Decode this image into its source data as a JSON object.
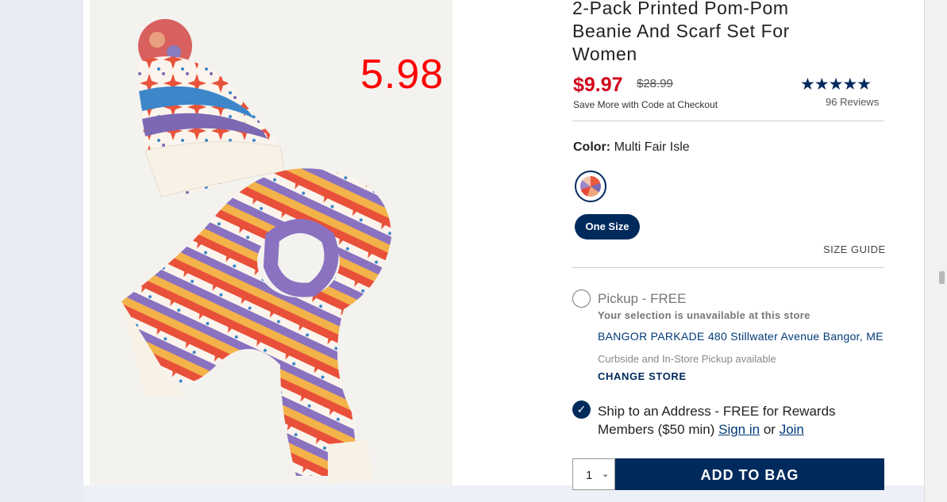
{
  "product": {
    "title": "2-Pack Printed Pom-Pom Beanie And Scarf Set For Women",
    "overlay_price": "5.98",
    "sale_price": "$9.97",
    "original_price": "$28.99",
    "save_note": "Save More with Code at Checkout",
    "rating_stars": "★★★★★",
    "rating": 5,
    "reviews": "96 Reviews"
  },
  "color": {
    "label": "Color:",
    "value": "Multi Fair Isle",
    "swatch_icon": "fair-isle-swatch"
  },
  "size": {
    "selected": "One Size",
    "guide_label": "SIZE GUIDE"
  },
  "fulfillment": {
    "pickup_label": "Pickup - FREE",
    "pickup_unavailable": "Your selection is unavailable at this store",
    "store_name": "BANGOR PARKADE 480 Stillwater Avenue  Bangor, ME",
    "curbside": "Curbside and In-Store Pickup available",
    "change_store": "CHANGE STORE",
    "ship_label": "Ship to an Address - FREE for Rewards Members ($50 min)",
    "sign_in": "Sign in",
    "or": "or",
    "join": "Join",
    "ship_selected": true
  },
  "cart": {
    "quantity": "1",
    "add_to_bag": "ADD TO BAG"
  },
  "colors": {
    "navy": "#002a5c",
    "sale_red": "#d0021b",
    "overlay_red": "#ff0000"
  }
}
